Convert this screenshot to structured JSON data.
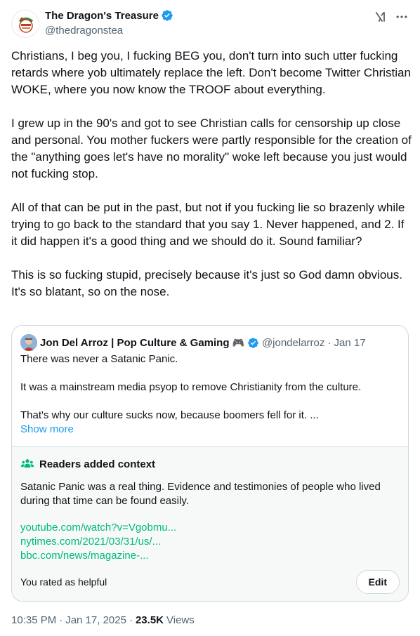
{
  "author": {
    "name": "The Dragon's Treasure",
    "handle": "@thedragonstea",
    "verified_color": "#1d9bf0"
  },
  "tweet": {
    "paragraphs": [
      "Christians, I beg you, I fucking BEG you, don't turn into such utter fucking retards where yob ultimately replace the left. Don't become Twitter Christian WOKE, where you now know the TROOF about everything.",
      "I grew up in the 90's and got to see Christian calls for censorship up close and personal. You mother fuckers were partly responsible for the creation of the \"anything goes let's have no morality\" woke left because you just would not fucking stop.",
      "All of that can be put in the past, but not if you fucking lie so brazenly while trying to go back to the standard that you say 1. Never happened, and 2. If it did happen it's a good thing and we should do it. Sound familiar?",
      "This is so fucking stupid, precisely because it's just so God damn obvious. It's so blatant, so on the nose."
    ]
  },
  "quote": {
    "name": "Jon Del Arroz | Pop Culture & Gaming",
    "name_emoji": "🎮",
    "handle": "@jondelarroz",
    "date": "· Jan 17",
    "paragraphs": [
      "There was never a Satanic Panic.",
      "It was a mainstream media psyop to remove Christianity from the culture.",
      "That's why our culture sucks now, because boomers fell for it. ..."
    ],
    "show_more": "Show more"
  },
  "context": {
    "heading": "Readers added context",
    "text": "Satanic Panic was a real thing. Evidence and testimonies of people who lived during that time can be found easily.",
    "links": [
      "youtube.com/watch?v=Vgobmu...",
      "nytimes.com/2021/03/31/us/...",
      "bbc.com/news/magazine-..."
    ],
    "link_color": "#00ba7c",
    "rated": "You rated as helpful",
    "edit_label": "Edit"
  },
  "meta": {
    "time": "10:35 PM",
    "separator": "·",
    "date": "Jan 17, 2025",
    "views_count": "23.5K",
    "views_label": "Views"
  }
}
